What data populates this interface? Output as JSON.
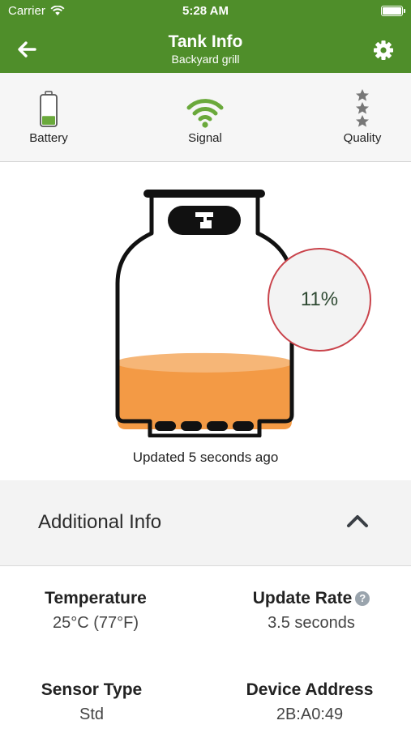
{
  "status_bar": {
    "carrier": "Carrier",
    "time": "5:28 AM"
  },
  "nav": {
    "title": "Tank Info",
    "subtitle": "Backyard grill",
    "back_icon": "arrow-left-icon",
    "settings_icon": "gear-icon"
  },
  "info_strip": {
    "battery": {
      "label": "Battery",
      "icon": "battery-icon",
      "level": 0.3
    },
    "signal": {
      "label": "Signal",
      "icon": "wifi-signal-icon"
    },
    "quality": {
      "label": "Quality",
      "icon": "stars-icon"
    }
  },
  "tank": {
    "percent": "11%",
    "level": 0.11,
    "updated": "Updated 5 seconds ago"
  },
  "additional_info": {
    "title": "Additional Info",
    "expanded": true,
    "items": {
      "temperature": {
        "label": "Temperature",
        "value": "25°C (77°F)"
      },
      "update_rate": {
        "label": "Update Rate",
        "value": "3.5 seconds",
        "help": "?"
      },
      "sensor_type": {
        "label": "Sensor Type",
        "value": "Std"
      },
      "device_address": {
        "label": "Device Address",
        "value": "2B:A0:49"
      }
    }
  },
  "colors": {
    "brand_green": "#4f8e2a",
    "signal_green": "#6aa93b",
    "propane_orange": "#f39a45",
    "badge_border": "#c9434b"
  }
}
